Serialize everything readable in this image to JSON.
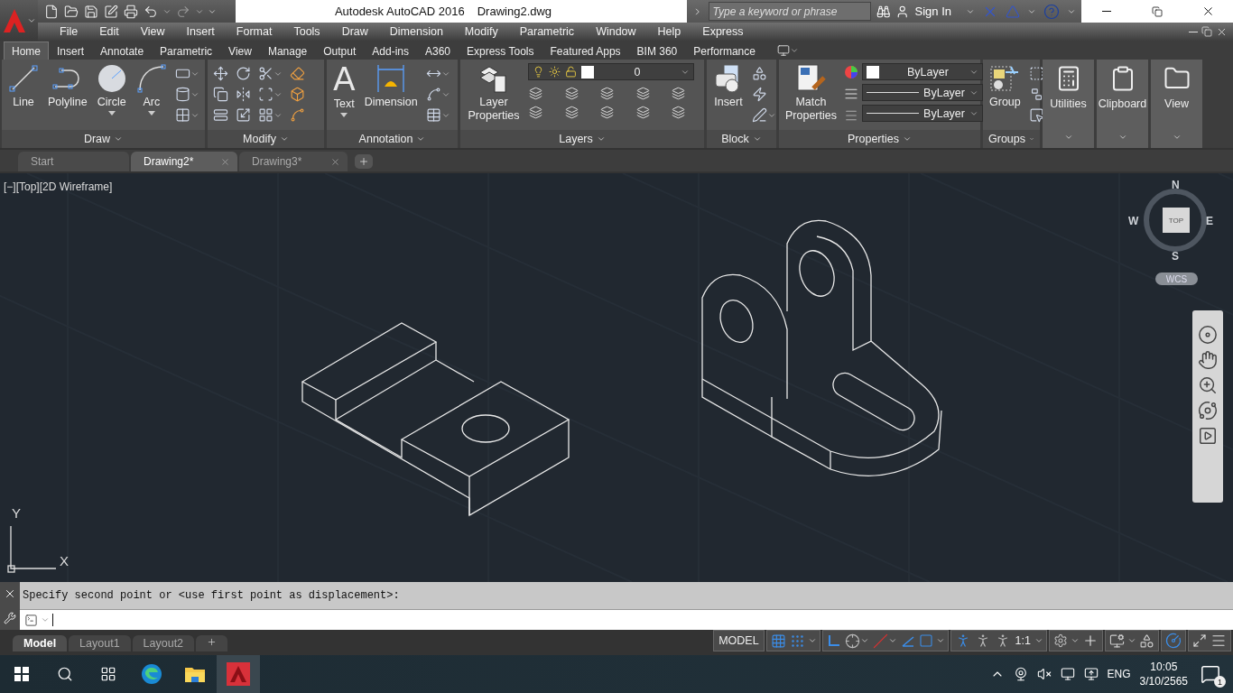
{
  "title_bar": {
    "title": "Autodesk AutoCAD 2016",
    "document": "Drawing2.dwg"
  },
  "info_center": {
    "search": {
      "placeholder": "Type a keyword or phrase"
    },
    "sign_in": "Sign In"
  },
  "menu_bar": [
    "File",
    "Edit",
    "View",
    "Insert",
    "Format",
    "Tools",
    "Draw",
    "Dimension",
    "Modify",
    "Parametric",
    "Window",
    "Help",
    "Express"
  ],
  "ribbon": {
    "tabs": [
      {
        "label": "Home",
        "selected": true
      },
      {
        "label": "Insert",
        "selected": false
      },
      {
        "label": "Annotate",
        "selected": false
      },
      {
        "label": "Parametric",
        "selected": false
      },
      {
        "label": "View",
        "selected": false
      },
      {
        "label": "Manage",
        "selected": false
      },
      {
        "label": "Output",
        "selected": false
      },
      {
        "label": "Add-ins",
        "selected": false
      },
      {
        "label": "A360",
        "selected": false
      },
      {
        "label": "Express Tools",
        "selected": false
      },
      {
        "label": "Featured Apps",
        "selected": false
      },
      {
        "label": "BIM 360",
        "selected": false
      },
      {
        "label": "Performance",
        "selected": false
      }
    ],
    "panels": [
      {
        "kind": "tools",
        "title": "Draw",
        "tools": [
          {
            "kind": "line",
            "label": "Line",
            "menu": false
          },
          {
            "kind": "polyline",
            "label": "Polyline",
            "menu": false
          },
          {
            "kind": "circle",
            "label": "Circle",
            "menu": true
          },
          {
            "kind": "arc",
            "label": "Arc",
            "menu": true
          }
        ]
      },
      {
        "kind": "tools",
        "title": "Modify"
      },
      {
        "kind": "tools",
        "title": "Annotation",
        "tools": [
          {
            "kind": "text",
            "label": "Text",
            "glyph": "A",
            "menu": true
          },
          {
            "kind": "dimension",
            "label": "Dimension",
            "menu": false
          }
        ]
      },
      {
        "kind": "tools",
        "title": "Layers",
        "tools": [
          {
            "kind": "layers",
            "label": "Layer Properties",
            "menu": false
          }
        ],
        "layer": "0"
      },
      {
        "kind": "tools",
        "title": "Block",
        "tools": [
          {
            "kind": "insert",
            "label": "Insert",
            "menu": false
          }
        ]
      },
      {
        "kind": "tools",
        "title": "Properties",
        "tools": [
          {
            "kind": "match",
            "label": "Match Properties",
            "menu": false
          }
        ],
        "dropdowns": [
          "ByLayer",
          "ByLayer",
          "ByLayer"
        ]
      },
      {
        "kind": "tools",
        "title": "Groups",
        "tools": [
          {
            "kind": "group",
            "label": "Group",
            "menu": false
          }
        ]
      },
      {
        "kind": "collapsed",
        "label": "Utilities"
      },
      {
        "kind": "collapsed",
        "label": "Clipboard"
      },
      {
        "kind": "collapsed",
        "label": "View"
      }
    ]
  },
  "document_tabs": [
    {
      "label": "Start",
      "selected": false
    },
    {
      "label": "Drawing2*",
      "selected": true
    },
    {
      "label": "Drawing3*",
      "selected": false
    }
  ],
  "viewport": {
    "label": "[−][Top][2D Wireframe]",
    "view_cube": {
      "north": "N",
      "south": "S",
      "east": "E",
      "west": "W",
      "face": "TOP",
      "coordinate_system": "WCS"
    },
    "ucs": {
      "y": "Y",
      "x": "X"
    }
  },
  "command_line": {
    "history": "Specify second point or <use first point as displacement>:"
  },
  "layout_tabs": [
    {
      "label": "Model",
      "selected": true
    },
    {
      "label": "Layout1",
      "selected": false
    },
    {
      "label": "Layout2",
      "selected": false
    }
  ],
  "status_bar": {
    "mode": "MODEL",
    "scale": "1:1"
  },
  "taskbar": {
    "language": "ENG",
    "time": "10:05",
    "date": "3/10/2565",
    "notifications": "1"
  }
}
